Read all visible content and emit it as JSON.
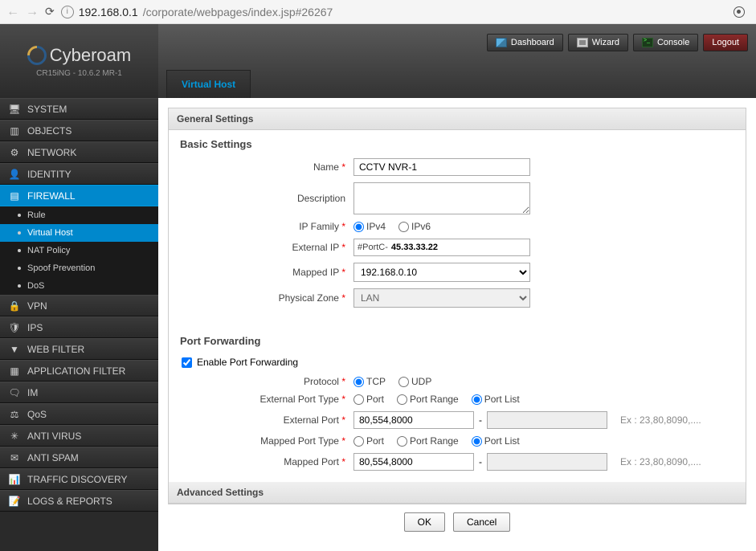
{
  "browser": {
    "url_host": "192.168.0.1",
    "url_path": "/corporate/webpages/index.jsp#26267"
  },
  "brand": {
    "name": "Cyberoam",
    "version": "CR15iNG - 10.6.2 MR-1"
  },
  "topbar": {
    "dashboard": "Dashboard",
    "wizard": "Wizard",
    "console": "Console",
    "logout": "Logout"
  },
  "tabs": [
    "Virtual Host"
  ],
  "nav": {
    "items": [
      {
        "label": "SYSTEM",
        "icon": "🖥"
      },
      {
        "label": "OBJECTS",
        "icon": "▥"
      },
      {
        "label": "NETWORK",
        "icon": "⚙"
      },
      {
        "label": "IDENTITY",
        "icon": "👤"
      },
      {
        "label": "FIREWALL",
        "icon": "▤",
        "active": true,
        "subs": [
          {
            "label": "Rule"
          },
          {
            "label": "Virtual Host",
            "active": true
          },
          {
            "label": "NAT Policy"
          },
          {
            "label": "Spoof Prevention"
          },
          {
            "label": "DoS"
          }
        ]
      },
      {
        "label": "VPN",
        "icon": "🔒"
      },
      {
        "label": "IPS",
        "icon": "🛡"
      },
      {
        "label": "WEB FILTER",
        "icon": "▼"
      },
      {
        "label": "APPLICATION FILTER",
        "icon": "▦"
      },
      {
        "label": "IM",
        "icon": "🗨"
      },
      {
        "label": "QoS",
        "icon": "⚖"
      },
      {
        "label": "ANTI VIRUS",
        "icon": "✳"
      },
      {
        "label": "ANTI SPAM",
        "icon": "✉"
      },
      {
        "label": "TRAFFIC DISCOVERY",
        "icon": "📊"
      },
      {
        "label": "LOGS & REPORTS",
        "icon": "📝"
      }
    ]
  },
  "form": {
    "general_header": "General Settings",
    "basic_header": "Basic Settings",
    "name_label": "Name",
    "name_value": "CCTV NVR-1",
    "desc_label": "Description",
    "desc_value": "",
    "ipfamily_label": "IP Family",
    "ipv4": "IPv4",
    "ipv6": "IPv6",
    "extip_label": "External IP",
    "extip_prefix": "#PortC-",
    "extip_value": "45.33.33.22",
    "mappedip_label": "Mapped IP",
    "mappedip_value": "192.168.0.10",
    "zone_label": "Physical Zone",
    "zone_value": "LAN",
    "pf_header": "Port Forwarding",
    "pf_enable": "Enable Port Forwarding",
    "protocol_label": "Protocol",
    "tcp": "TCP",
    "udp": "UDP",
    "ext_port_type_label": "External Port Type",
    "mapped_port_type_label": "Mapped Port Type",
    "port_opt": "Port",
    "portrange_opt": "Port Range",
    "portlist_opt": "Port List",
    "ext_port_label": "External Port",
    "ext_port_value": "80,554,8000",
    "mapped_port_label": "Mapped Port",
    "mapped_port_value": "80,554,8000",
    "port_hint": "Ex : 23,80,8090,....",
    "advanced_header": "Advanced Settings",
    "ok": "OK",
    "cancel": "Cancel",
    "dash": "-"
  }
}
